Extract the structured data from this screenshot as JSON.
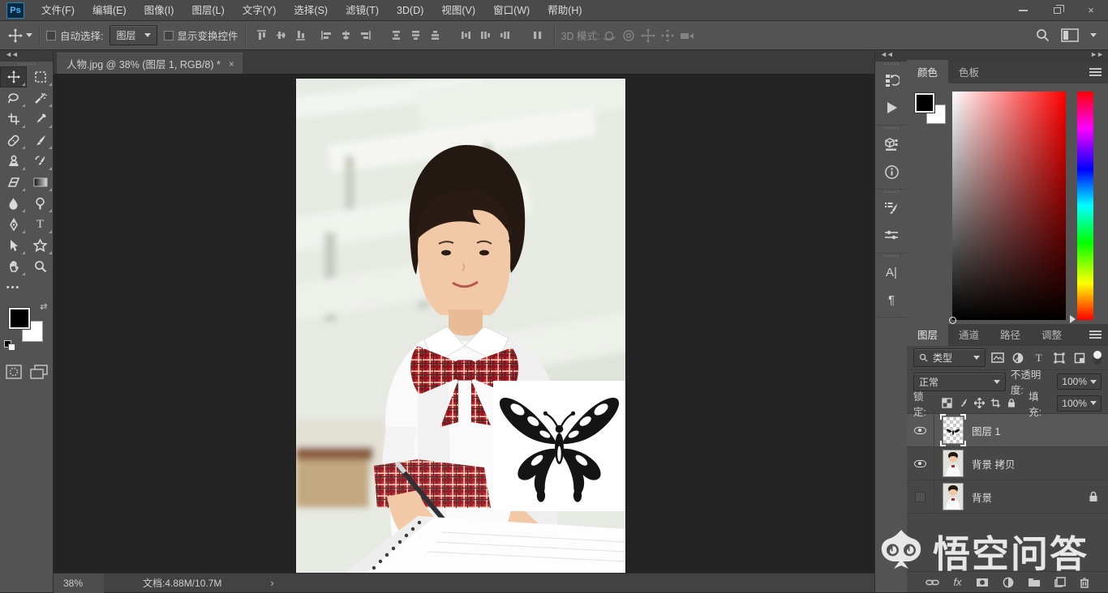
{
  "window": {
    "controls": {
      "close": "×"
    }
  },
  "menu_bar": {
    "logo": "Ps",
    "items": [
      "文件(F)",
      "编辑(E)",
      "图像(I)",
      "图层(L)",
      "文字(Y)",
      "选择(S)",
      "滤镜(T)",
      "3D(D)",
      "视图(V)",
      "窗口(W)",
      "帮助(H)"
    ]
  },
  "options_bar": {
    "auto_select_label": "自动选择:",
    "auto_select_value": "图层",
    "show_transform_label": "显示变换控件",
    "mode_3d_label": "3D 模式:"
  },
  "document_tab": {
    "title": "人物.jpg @ 38% (图层 1, RGB/8) *",
    "close": "×"
  },
  "icons": {
    "collapse_left": "◄◄",
    "collapse_right": "►►",
    "status_chevron": "›",
    "swap": "⇄"
  },
  "color_panel": {
    "tabs": [
      "颜色",
      "色板"
    ]
  },
  "layers_panel": {
    "tabs": [
      "图层",
      "通道",
      "路径",
      "调整"
    ],
    "filter_label": "类型",
    "blend_mode": "正常",
    "opacity_label": "不透明度:",
    "opacity_value": "100%",
    "lock_label": "锁定:",
    "fill_label": "填充:",
    "fill_value": "100%",
    "layers": [
      {
        "name": "图层 1",
        "visible": true,
        "selected": true
      },
      {
        "name": "背景 拷贝",
        "visible": true,
        "selected": false
      },
      {
        "name": "背景",
        "visible": false,
        "selected": false,
        "locked": true
      }
    ]
  },
  "status_bar": {
    "zoom": "38%",
    "doc_info": "文档:4.88M/10.7M"
  },
  "watermark": {
    "text": "悟空问答"
  }
}
